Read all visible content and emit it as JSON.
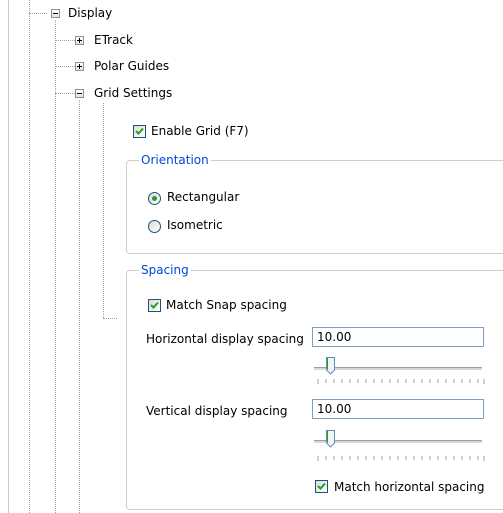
{
  "tree": {
    "display_label": "Display",
    "children": [
      {
        "label": "ETrack",
        "expanded": false
      },
      {
        "label": "Polar Guides",
        "expanded": false
      },
      {
        "label": "Grid Settings",
        "expanded": true
      }
    ]
  },
  "grid_settings": {
    "enable_grid": {
      "label": "Enable Grid (F7)",
      "checked": true
    },
    "orientation": {
      "title": "Orientation",
      "options": [
        {
          "label": "Rectangular",
          "selected": true
        },
        {
          "label": "Isometric",
          "selected": false
        }
      ]
    },
    "spacing": {
      "title": "Spacing",
      "match_snap": {
        "label": "Match Snap spacing",
        "checked": true
      },
      "horizontal": {
        "label": "Horizontal display spacing",
        "value": "10.00",
        "slider_level": 0.1
      },
      "vertical": {
        "label": "Vertical display spacing",
        "value": "10.00",
        "slider_level": 0.1
      },
      "match_horizontal": {
        "label": "Match horizontal spacing",
        "checked": true
      }
    }
  },
  "colors": {
    "group_title": "#0046d5",
    "check_mark": "#21a121",
    "input_border": "#7f9db9"
  }
}
